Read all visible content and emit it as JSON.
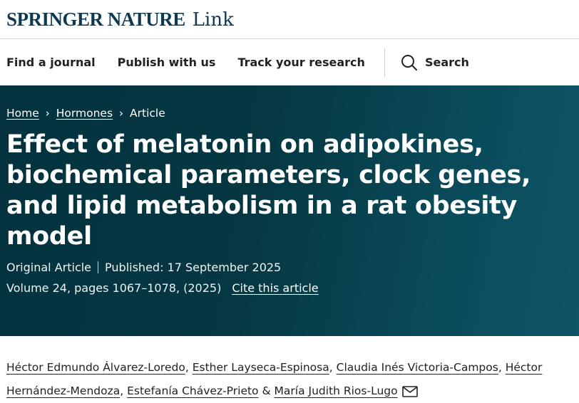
{
  "brand": {
    "name": "SPRINGER NATURE",
    "product": "Link"
  },
  "nav": {
    "items": [
      "Find a journal",
      "Publish with us",
      "Track your research"
    ],
    "search_label": "Search"
  },
  "breadcrumb": {
    "home": "Home",
    "journal": "Hormones",
    "current": "Article"
  },
  "article": {
    "title": "Effect of melatonin on adipokines, biochemical parameters, clock genes, and lipid metabolism in a rat obesity model",
    "type": "Original Article",
    "published": "Published: 17 September 2025",
    "volume": "Volume 24, pages 1067–1078, (2025)",
    "cite_label": "Cite this article"
  },
  "authors": {
    "list": [
      "Héctor Edmundo Álvarez-Loredo",
      "Esther Layseca-Espinosa",
      "Claudia Inés Victoria-Campos",
      "Héctor Hernández-Mendoza",
      "Estefanía Chávez-Prieto",
      "María Judith Rios-Lugo"
    ],
    "sep": ",",
    "and": "&"
  },
  "colors": {
    "hero": "#04323f",
    "brand": "#0d3a52"
  }
}
